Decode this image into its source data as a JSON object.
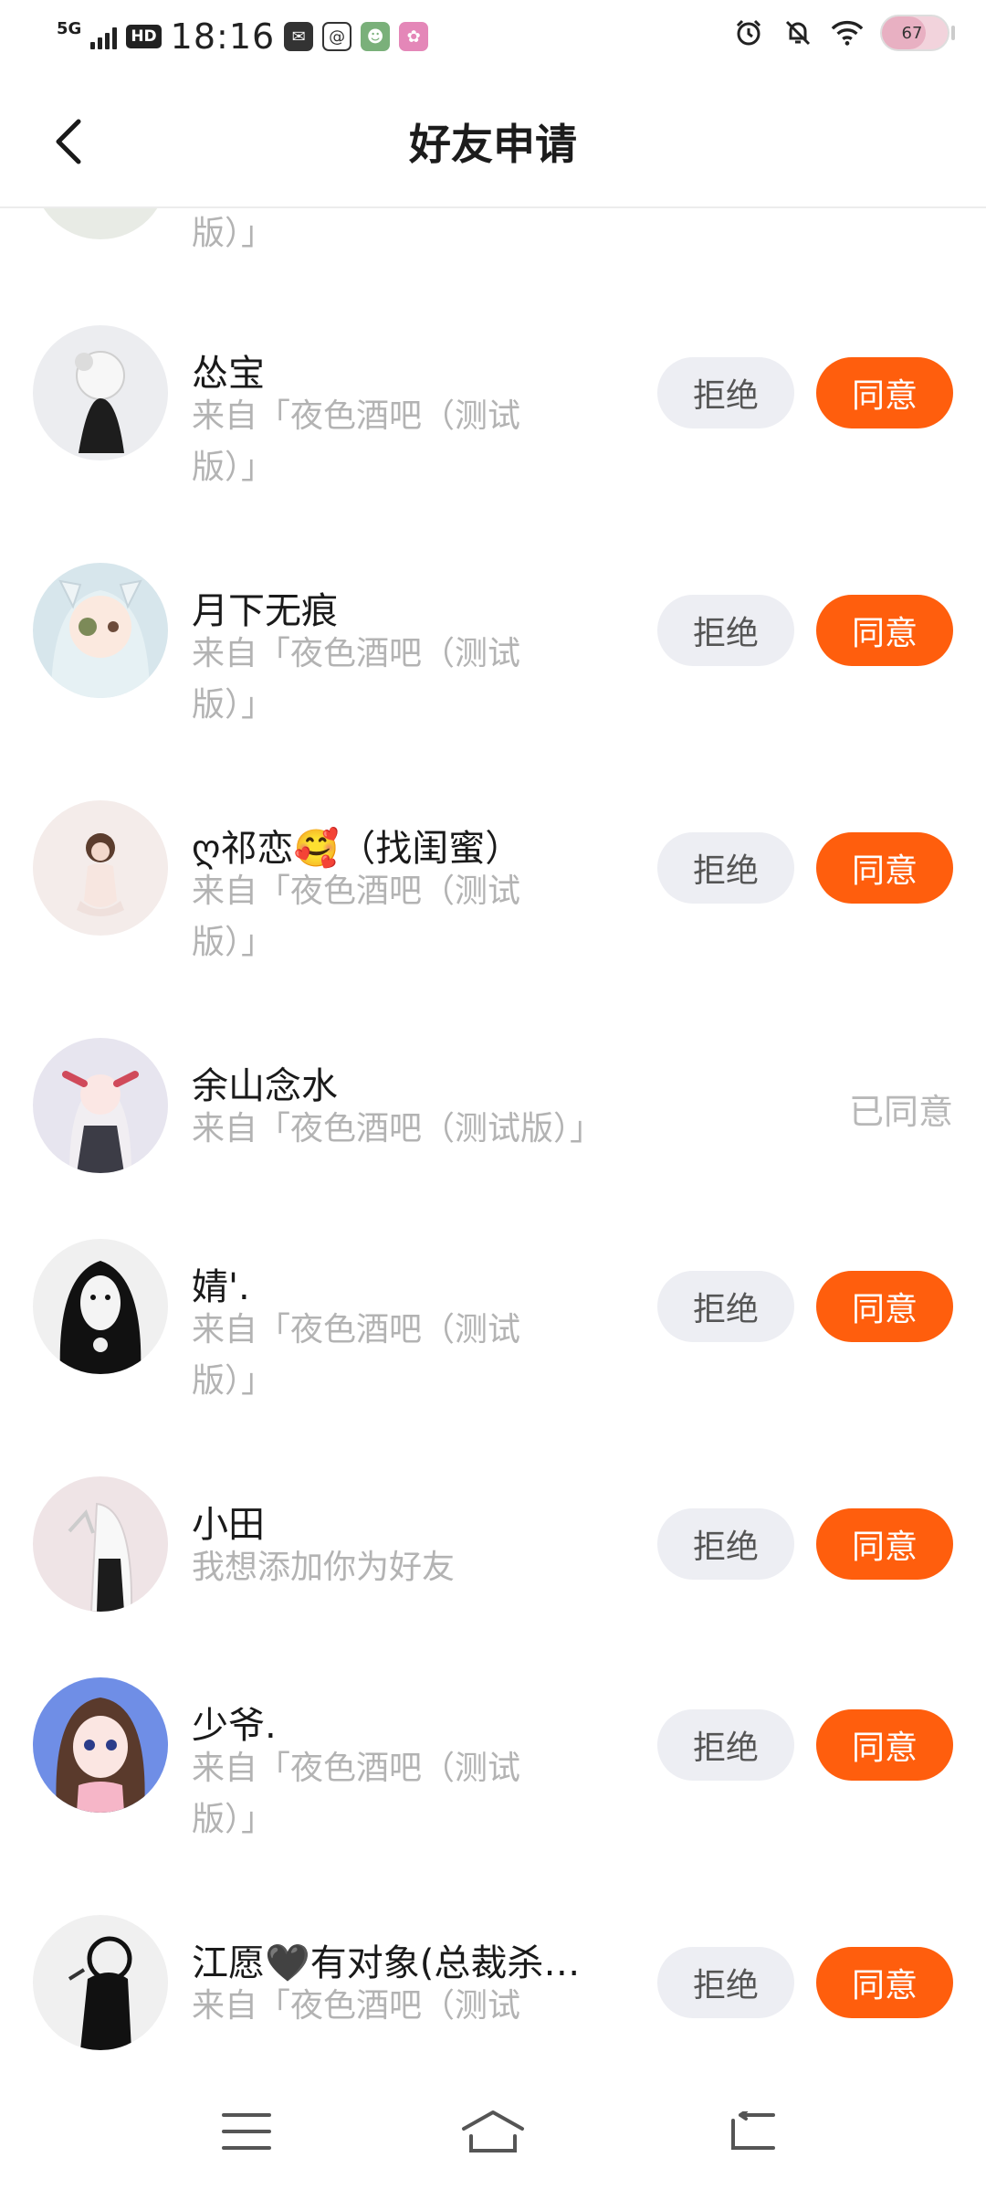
{
  "status": {
    "network": "5G",
    "hd": "HD",
    "time": "18:16",
    "battery": "67",
    "battery_level": 0.67
  },
  "header": {
    "title": "好友申请"
  },
  "partial_top": {
    "sub_line2": "版）」"
  },
  "requests": [
    {
      "name": "怂宝",
      "sub1": "来自「夜色酒吧（测试",
      "sub2": "版）」",
      "state": "pending",
      "reject": "拒绝",
      "agree": "同意"
    },
    {
      "name": "月下无痕",
      "sub1": "来自「夜色酒吧（测试",
      "sub2": "版）」",
      "state": "pending",
      "reject": "拒绝",
      "agree": "同意"
    },
    {
      "name": "ღ祁恋🥰（找闺蜜）",
      "sub1": "来自「夜色酒吧（测试",
      "sub2": "版）」",
      "state": "pending",
      "reject": "拒绝",
      "agree": "同意"
    },
    {
      "name": "余山念水",
      "sub1": "来自「夜色酒吧（测试版）」",
      "sub2": "",
      "state": "agreed",
      "agreed_label": "已同意"
    },
    {
      "name": "婧'.",
      "sub1": "来自「夜色酒吧（测试",
      "sub2": "版）」",
      "state": "pending",
      "reject": "拒绝",
      "agree": "同意"
    },
    {
      "name": "小田",
      "sub1": "我想添加你为好友",
      "sub2": "",
      "state": "pending",
      "reject": "拒绝",
      "agree": "同意"
    },
    {
      "name": "少爷.",
      "sub1": "来自「夜色酒吧（测试",
      "sub2": "版）」",
      "state": "pending",
      "reject": "拒绝",
      "agree": "同意"
    },
    {
      "name": "江愿🖤有对象(总裁杀…",
      "sub1": "来自「夜色酒吧（测试",
      "sub2": "",
      "state": "pending",
      "reject": "拒绝",
      "agree": "同意"
    }
  ],
  "navbar": {
    "items": [
      "menu-icon",
      "home-icon",
      "back-icon"
    ]
  }
}
